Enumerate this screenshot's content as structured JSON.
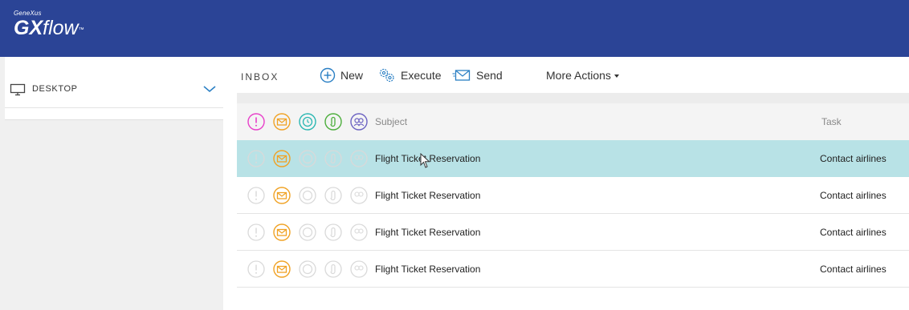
{
  "header": {
    "logo_small": "GeneXus",
    "logo_gx": "GX",
    "logo_flow": "flow",
    "logo_tm": "™",
    "brand_color": "#2b4496"
  },
  "sidebar": {
    "desktop_label": "DESKTOP",
    "desktop_icon": "monitor-icon",
    "expand_icon": "chevron-down-icon",
    "accent_color": "#2a7fc4"
  },
  "toolbar": {
    "inbox_label": "INBOX",
    "new_label": "New",
    "execute_label": "Execute",
    "send_label": "Send",
    "more_label": "More Actions"
  },
  "grid": {
    "columns": {
      "priority_icon": "exclamation-circle-icon",
      "unread_icon": "envelope-circle-icon",
      "deadline_icon": "clock-circle-icon",
      "attachment_icon": "paperclip-circle-icon",
      "role_icon": "people-circle-icon",
      "subject": "Subject",
      "task": "Task"
    },
    "colors": {
      "priority": "#e83fc9",
      "unread": "#f0a224",
      "deadline": "#2bb7b2",
      "attachment": "#4cae3c",
      "role": "#6c63c2",
      "selected_row": "#b8e2e6"
    },
    "rows": [
      {
        "subject": "Flight Ticket Reservation",
        "task": "Contact airlines",
        "selected": true
      },
      {
        "subject": "Flight Ticket Reservation",
        "task": "Contact airlines",
        "selected": false
      },
      {
        "subject": "Flight Ticket Reservation",
        "task": "Contact airlines",
        "selected": false
      },
      {
        "subject": "Flight Ticket Reservation",
        "task": "Contact airlines",
        "selected": false
      }
    ]
  }
}
